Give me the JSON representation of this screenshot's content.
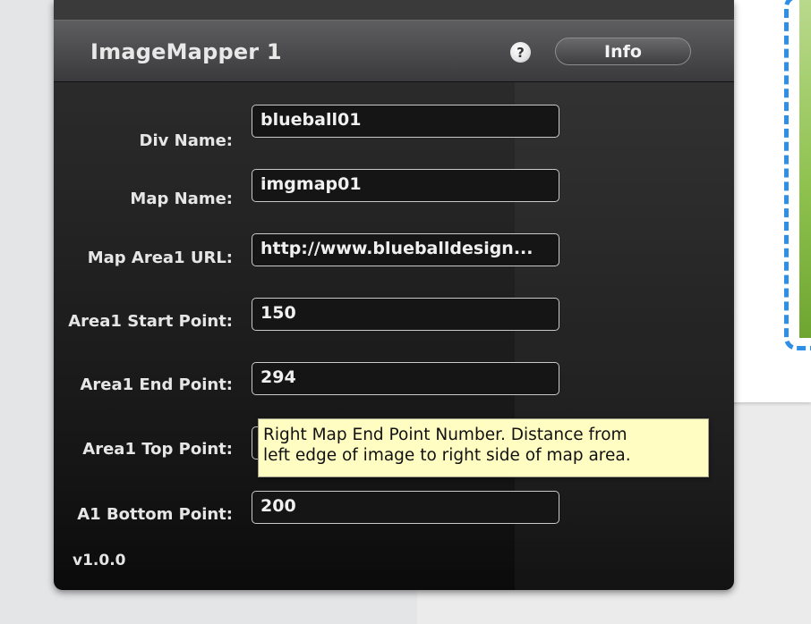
{
  "panel": {
    "title": "ImageMapper 1",
    "help_icon": "question-mark-icon",
    "help_glyph": "?",
    "info_label": "Info",
    "version": "v1.0.0"
  },
  "fields": [
    {
      "label": "Div Name:",
      "value": "blueball01"
    },
    {
      "label": "Map Name:",
      "value": "imgmap01"
    },
    {
      "label": "Map Area1 URL:",
      "value": "http://www.blueballdesign..."
    },
    {
      "label": "Area1 Start Point:",
      "value": "150"
    },
    {
      "label": "Area1 End Point:",
      "value": "294"
    },
    {
      "label": "Area1 Top Point:",
      "value": ""
    },
    {
      "label": "A1 Bottom Point:",
      "value": "200"
    }
  ],
  "tooltip": {
    "line1": "Right Map End Point Number. Distance from",
    "line2": "left edge of image to right side of map area."
  },
  "colors": {
    "panel_bg": "#1c1c1c",
    "tooltip_bg": "#fffdc2",
    "frame_dash": "#2f8ee6",
    "frame_fill": "#8fc24f"
  }
}
